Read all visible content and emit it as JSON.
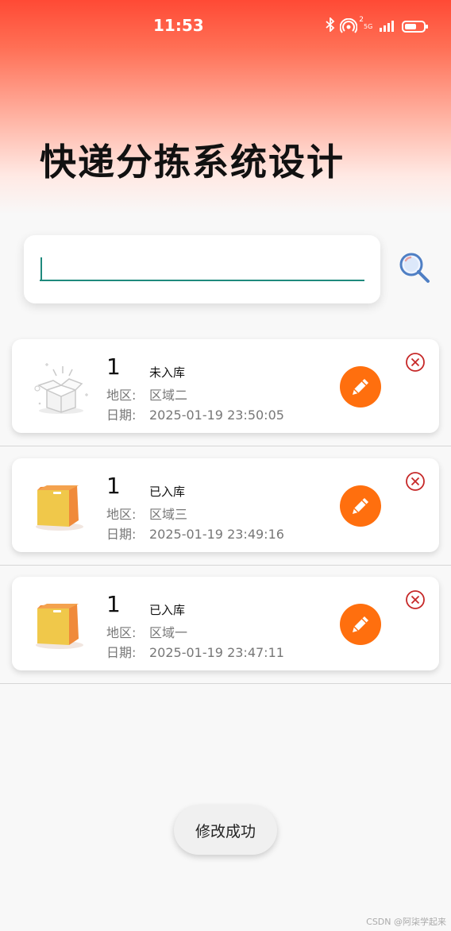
{
  "status_bar": {
    "time": "11:53",
    "hotspot_sup": "2",
    "network": "5G"
  },
  "app": {
    "title": "快递分拣系统设计"
  },
  "search": {
    "value": "",
    "placeholder": ""
  },
  "packages": [
    {
      "number": "1",
      "status": "未入库",
      "region_label": "地区:",
      "region": "区域二",
      "date_label": "日期:",
      "date": "2025-01-19 23:50:05",
      "icon": "empty-box-icon"
    },
    {
      "number": "1",
      "status": "已入库",
      "region_label": "地区:",
      "region": "区域三",
      "date_label": "日期:",
      "date": "2025-01-19 23:49:16",
      "icon": "package-box-icon"
    },
    {
      "number": "1",
      "status": "已入库",
      "region_label": "地区:",
      "region": "区域一",
      "date_label": "日期:",
      "date": "2025-01-19 23:47:11",
      "icon": "package-box-icon"
    }
  ],
  "toast": {
    "message": "修改成功"
  },
  "watermark": "CSDN @阿柒学起来",
  "colors": {
    "accent": "#ff6f0e",
    "header_top": "#ff4a35",
    "input_underline": "#1f8a7d",
    "delete": "#c62828"
  }
}
